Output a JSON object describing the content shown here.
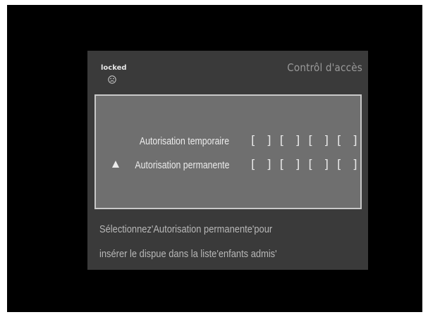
{
  "header": {
    "status_label": "locked",
    "status_icon": "sad-face-icon",
    "title": "Contrôl d'accès"
  },
  "panel": {
    "rows": [
      {
        "label": "Autorisation temporaire",
        "selected": false,
        "slots": [
          "[ ]",
          "[ ]",
          "[ ]",
          "[ ]"
        ]
      },
      {
        "label": "Autorisation permanente",
        "selected": true,
        "slots": [
          "[ ]",
          "[ ]",
          "[ ]",
          "[ ]"
        ]
      }
    ]
  },
  "help": {
    "line1": "Sélectionnez'Autorisation permanente'pour",
    "line2": "insérer le dispue dans la liste'enfants admis'"
  }
}
